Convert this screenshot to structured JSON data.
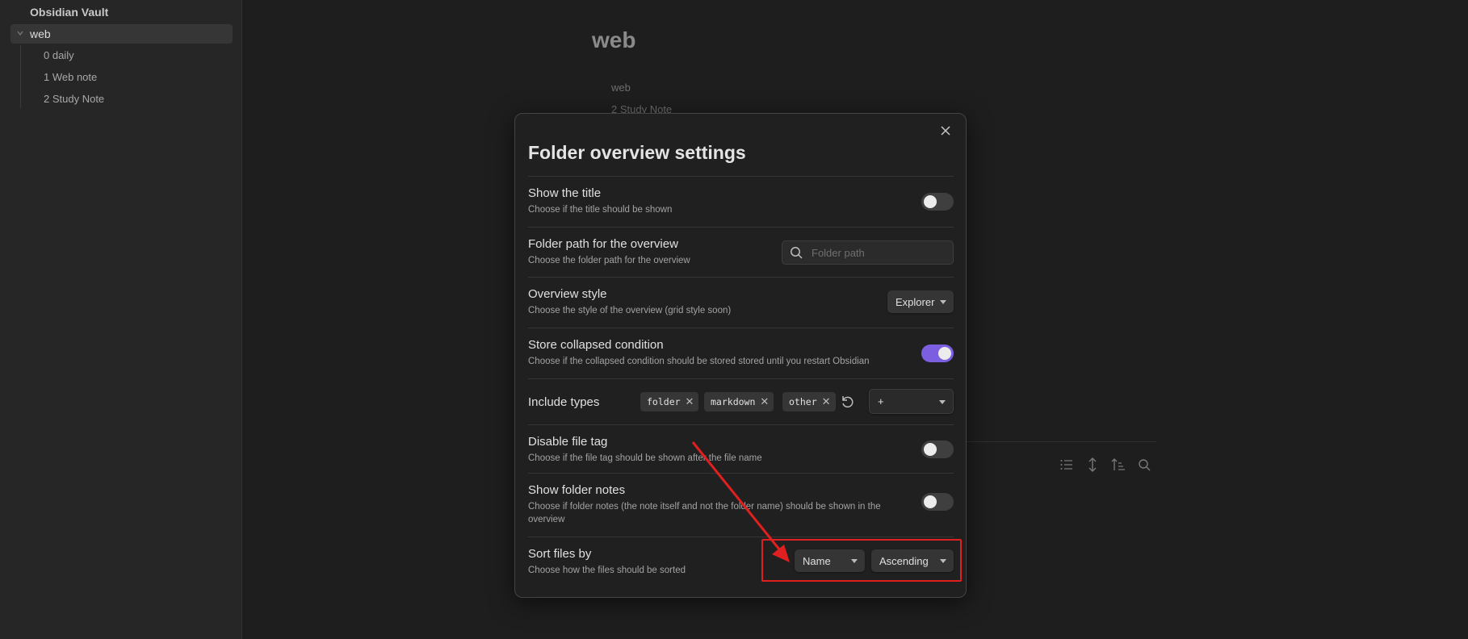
{
  "sidebar": {
    "vault_name": "Obsidian Vault",
    "folder": {
      "label": "web",
      "expanded": true
    },
    "files": [
      "0 daily",
      "1 Web note",
      "2 Study Note"
    ]
  },
  "editor": {
    "title": "web",
    "lines": [
      "web",
      "2 Study Note"
    ],
    "toolbar_icons": [
      "list-icon",
      "expand-vertical-icon",
      "sort-icon",
      "search-icon"
    ]
  },
  "modal": {
    "title": "Folder overview settings",
    "close_icon": "close-icon",
    "settings": {
      "show_title": {
        "name": "Show the title",
        "desc": "Choose if the title should be shown",
        "enabled": false
      },
      "folder_path": {
        "name": "Folder path for the overview",
        "desc": "Choose the folder path for the overview",
        "placeholder": "Folder path",
        "value": ""
      },
      "overview_style": {
        "name": "Overview style",
        "desc": "Choose the style of the overview (grid style soon)",
        "value": "Explorer"
      },
      "store_collapsed": {
        "name": "Store collapsed condition",
        "desc": "Choose if the collapsed condition should be stored stored until you restart Obsidian",
        "enabled": true
      },
      "include_types": {
        "name": "Include types",
        "tags": [
          "folder",
          "markdown",
          "other"
        ],
        "add_label": "+"
      },
      "disable_file_tag": {
        "name": "Disable file tag",
        "desc": "Choose if the file tag should be shown after the file name",
        "enabled": false
      },
      "show_folder_notes": {
        "name": "Show folder notes",
        "desc": "Choose if folder notes (the note itself and not the folder name) should be shown in the overview",
        "enabled": false
      },
      "sort_files": {
        "name": "Sort files by",
        "desc": "Choose how the files should be sorted",
        "sort_by": "Name",
        "order": "Ascending"
      }
    }
  },
  "colors": {
    "accent": "#7c5fe0",
    "annotation": "#e02020"
  }
}
